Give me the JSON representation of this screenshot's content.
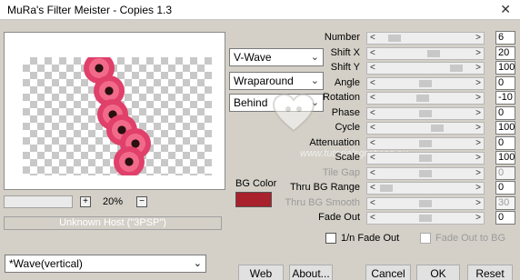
{
  "window": {
    "title": "MuRa's Filter Meister - Copies 1.3",
    "close_glyph": "✕"
  },
  "preview": {
    "zoom_minus": "−",
    "zoom_plus": "+",
    "zoom_value": "20%",
    "host_text": "Unknown Host (\"3PSP\")"
  },
  "selects": {
    "wave": "V-Wave",
    "wrap": "Wraparound",
    "order": "Behind",
    "preset": "*Wave(vertical)"
  },
  "bg": {
    "label": "BG Color",
    "color": "#a8212c"
  },
  "params": [
    {
      "label": "Number",
      "value": "6",
      "level": 0.1,
      "disabled": false
    },
    {
      "label": "Shift X",
      "value": "20",
      "level": 0.6,
      "disabled": false
    },
    {
      "label": "Shift Y",
      "value": "100",
      "level": 0.9,
      "disabled": false
    },
    {
      "label": "Angle",
      "value": "0",
      "level": 0.5,
      "disabled": false
    },
    {
      "label": "Rotation",
      "value": "-10",
      "level": 0.47,
      "disabled": false
    },
    {
      "label": "Phase",
      "value": "0",
      "level": 0.5,
      "disabled": false
    },
    {
      "label": "Cycle",
      "value": "100",
      "level": 0.65,
      "disabled": false
    },
    {
      "label": "Attenuation",
      "value": "0",
      "level": 0.5,
      "disabled": false
    },
    {
      "label": "Scale",
      "value": "100",
      "level": 0.5,
      "disabled": false
    },
    {
      "label": "Tile Gap",
      "value": "0",
      "level": 0.5,
      "disabled": true
    },
    {
      "label": "Thru BG Range",
      "value": "0",
      "level": 0.0,
      "disabled": false
    },
    {
      "label": "Thru BG Smooth",
      "value": "30",
      "level": 0.5,
      "disabled": true
    },
    {
      "label": "Fade Out",
      "value": "0",
      "level": 0.5,
      "disabled": false
    }
  ],
  "checks": {
    "fade_1n": "1/n Fade Out",
    "fade_bg": "Fade Out to BG"
  },
  "buttons": {
    "web": "Web",
    "about": "About...",
    "cancel": "Cancel",
    "ok": "OK",
    "reset": "Reset"
  },
  "watermark": "www.tutorialsgraficas.eu",
  "arrows": {
    "left": "<",
    "right": ">",
    "down": "⌄"
  }
}
